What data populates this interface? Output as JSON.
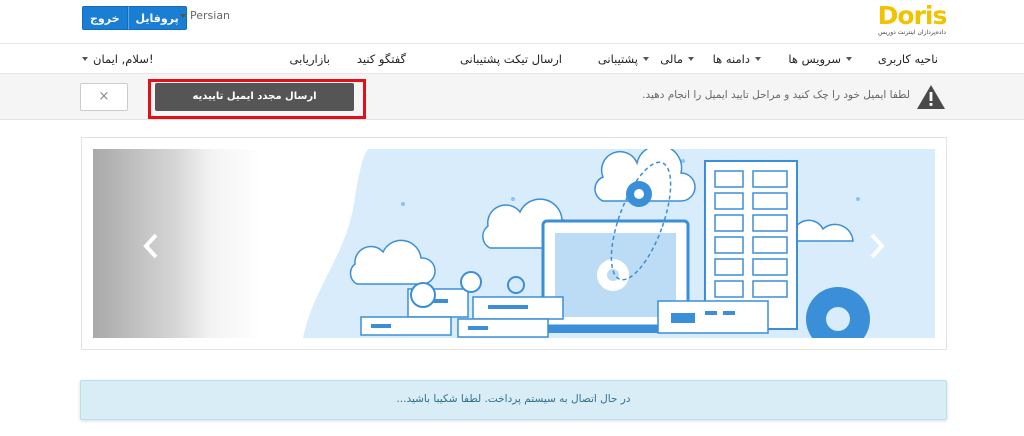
{
  "header": {
    "logout_label": "خروج",
    "profile_label": "پروفایل",
    "language_label": "Persian",
    "logo_text": "Doris",
    "logo_subtitle": "داده‌پردازان اینترنت دوریس"
  },
  "nav": {
    "items": [
      {
        "label": "ناحیه کاربری",
        "has_caret": false
      },
      {
        "label": "سرویس ها",
        "has_caret": true
      },
      {
        "label": "دامنه ها",
        "has_caret": true
      },
      {
        "label": "مالی",
        "has_caret": true
      },
      {
        "label": "پشتیبانی",
        "has_caret": true
      },
      {
        "label": "ارسال تیکت پشتیبانی",
        "has_caret": false
      },
      {
        "label": "گفتگو کنید",
        "has_caret": false
      },
      {
        "label": "بازاریابی",
        "has_caret": false
      }
    ],
    "greeting": "سلام, ایمان!"
  },
  "alert": {
    "message": "لطفا ایمیل خود را چک کنید و مراحل تایید ایمیل را انجام دهید.",
    "resend_label": "ارسال مجدد ایمیل تاییدیه",
    "close_label": "×",
    "highlight_color": "#e3101a"
  },
  "info": {
    "message": "در حال اتصال به سیستم پرداخت. لطفا شکیبا باشید..."
  },
  "colors": {
    "primary": "#1a7fd4",
    "logo": "#f2c200",
    "illustration_blue": "#3a8fd8",
    "illustration_light": "#bcdcf5"
  }
}
